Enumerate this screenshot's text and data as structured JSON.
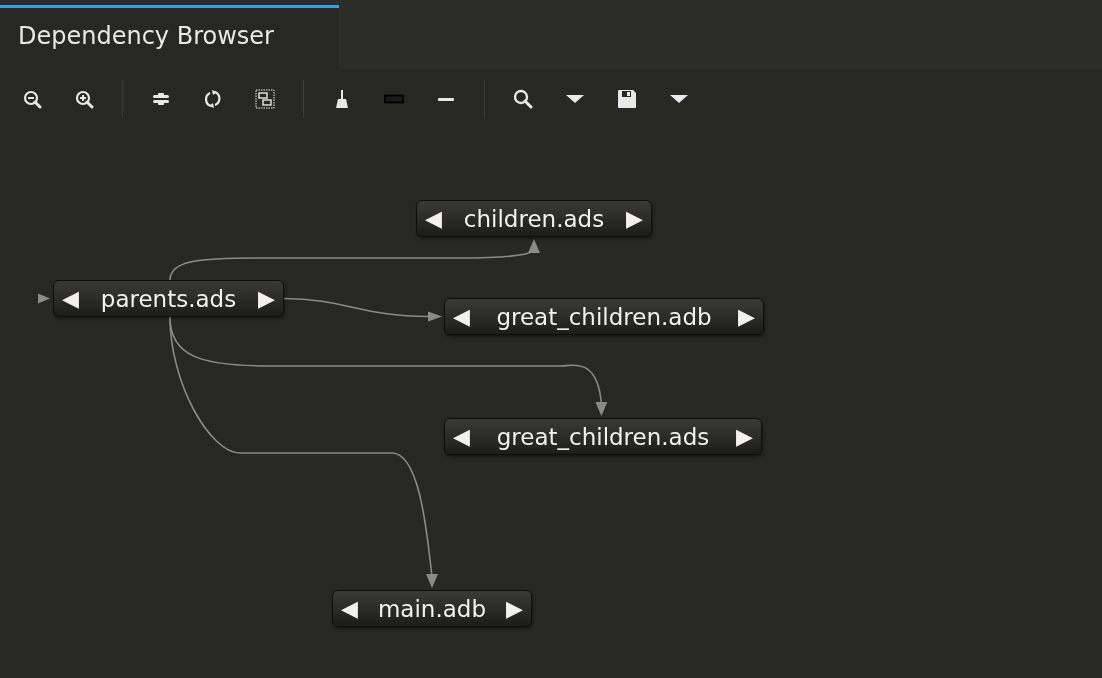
{
  "tabs": [
    {
      "label": "Dependency Browser",
      "selected": true
    }
  ],
  "nodes": [
    {
      "label": "children.ads",
      "left": "◀",
      "right": "▶"
    },
    {
      "label": "parents.ads",
      "left": "◀",
      "right": "▶"
    },
    {
      "label": "great_children.adb",
      "left": "◀",
      "right": "▶"
    },
    {
      "label": "great_children.ads",
      "left": "◀",
      "right": "▶"
    },
    {
      "label": "main.adb",
      "left": "◀",
      "right": "▶"
    }
  ]
}
